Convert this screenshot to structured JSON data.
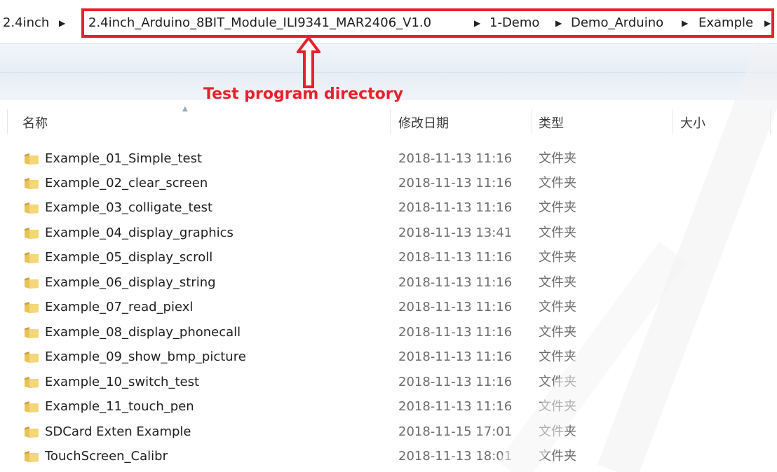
{
  "breadcrumb": {
    "items": [
      "2.4inch",
      "2.4inch_Arduino_8BIT_Module_ILI9341_MAR2406_V1.0",
      "1-Demo",
      "Demo_Arduino",
      "Example"
    ],
    "separator": "▶",
    "highlight_color": "#e8212a"
  },
  "annotation": {
    "label": "Test program directory",
    "color": "#e8212a"
  },
  "columns": {
    "name": "名称",
    "modified": "修改日期",
    "type": "类型",
    "size": "大小"
  },
  "files": [
    {
      "name": "Example_01_Simple_test",
      "modified": "2018-11-13 11:16",
      "type": "文件夹"
    },
    {
      "name": "Example_02_clear_screen",
      "modified": "2018-11-13 11:16",
      "type": "文件夹"
    },
    {
      "name": "Example_03_colligate_test",
      "modified": "2018-11-13 11:16",
      "type": "文件夹"
    },
    {
      "name": "Example_04_display_graphics",
      "modified": "2018-11-13 13:41",
      "type": "文件夹"
    },
    {
      "name": "Example_05_display_scroll",
      "modified": "2018-11-13 11:16",
      "type": "文件夹"
    },
    {
      "name": "Example_06_display_string",
      "modified": "2018-11-13 11:16",
      "type": "文件夹"
    },
    {
      "name": "Example_07_read_piexl",
      "modified": "2018-11-13 11:16",
      "type": "文件夹"
    },
    {
      "name": "Example_08_display_phonecall",
      "modified": "2018-11-13 11:16",
      "type": "文件夹"
    },
    {
      "name": "Example_09_show_bmp_picture",
      "modified": "2018-11-13 11:16",
      "type": "文件夹"
    },
    {
      "name": "Example_10_switch_test",
      "modified": "2018-11-13 11:16",
      "type": "文件夹"
    },
    {
      "name": "Example_11_touch_pen",
      "modified": "2018-11-13 11:16",
      "type": "文件夹"
    },
    {
      "name": "SDCard Exten Example",
      "modified": "2018-11-15 17:01",
      "type": "文件夹"
    },
    {
      "name": "TouchScreen_Calibr",
      "modified": "2018-11-13 18:01",
      "type": "文件夹"
    }
  ],
  "icons": {
    "folder": "folder-icon",
    "arrow": "up-arrow-icon"
  }
}
